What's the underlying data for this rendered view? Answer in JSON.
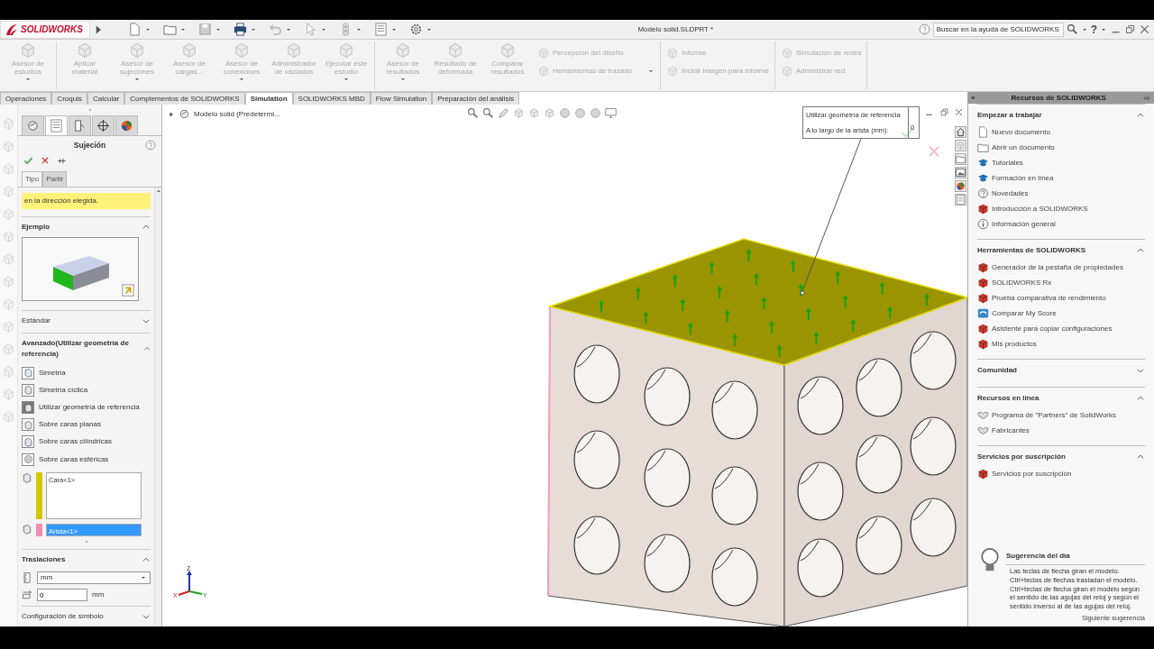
{
  "title_bar": {
    "logo": "SOLIDWORKS",
    "document_title": "Modelo solid.SLDPRT *",
    "search_placeholder": "Buscar en la ayuda de SOLIDWORKS",
    "help_label": "?"
  },
  "ribbon": {
    "groups": [
      {
        "items": [
          {
            "kind": "large",
            "label": "Asesor de estudios",
            "dropdown": true,
            "disabled": true
          }
        ]
      },
      {
        "items": [
          {
            "kind": "large",
            "label": "Aplicar material",
            "dropdown": false,
            "disabled": true
          },
          {
            "kind": "large",
            "label": "Asesor de sujeciones",
            "dropdown": true,
            "disabled": true
          },
          {
            "kind": "large",
            "label": "Asesor de cargas...",
            "dropdown": false,
            "disabled": true
          },
          {
            "kind": "large",
            "label": "Asesor de conexiones",
            "dropdown": true,
            "disabled": true
          },
          {
            "kind": "large",
            "label": "Administrador de vaciados",
            "dropdown": false,
            "disabled": true
          },
          {
            "kind": "large",
            "label": "Ejecutar este estudio",
            "dropdown": true,
            "disabled": true
          }
        ]
      },
      {
        "items": [
          {
            "kind": "large",
            "label": "Asesor de resultados",
            "dropdown": true,
            "disabled": true
          },
          {
            "kind": "large",
            "label": "Resultado de deformada",
            "dropdown": false,
            "disabled": true
          },
          {
            "kind": "large",
            "label": "Comparar resultados",
            "dropdown": false,
            "disabled": true
          },
          {
            "kind": "column",
            "items": [
              {
                "label": "Percepción del diseño",
                "dropdown": false,
                "disabled": true
              },
              {
                "label": "Herramientas de trazado",
                "dropdown": true,
                "disabled": true
              }
            ]
          }
        ]
      },
      {
        "items": [
          {
            "kind": "column",
            "items": [
              {
                "label": "Informe",
                "dropdown": false,
                "disabled": true
              },
              {
                "label": "Incluir imagen para informe",
                "dropdown": false,
                "disabled": true
              }
            ]
          }
        ]
      },
      {
        "items": [
          {
            "kind": "column",
            "items": [
              {
                "label": "Simulación de redes",
                "dropdown": false,
                "disabled": true
              },
              {
                "label": "Administrar red",
                "dropdown": false,
                "disabled": true
              }
            ]
          }
        ]
      }
    ]
  },
  "tabs": [
    {
      "label": "Operaciones",
      "selected": false
    },
    {
      "label": "Croquis",
      "selected": false
    },
    {
      "label": "Calcular",
      "selected": false
    },
    {
      "label": "Complementos de SOLIDWORKS",
      "selected": false
    },
    {
      "label": "Simulation",
      "selected": true
    },
    {
      "label": "SOLIDWORKS MBD",
      "selected": false
    },
    {
      "label": "Flow Simulation",
      "selected": false
    },
    {
      "label": "Preparación del análisis",
      "selected": false
    }
  ],
  "property_manager": {
    "tabs": [
      {
        "selected": false
      },
      {
        "selected": true
      },
      {
        "selected": false
      },
      {
        "selected": false
      },
      {
        "selected": false
      }
    ],
    "title": "Sujeción",
    "type_tabs": [
      {
        "label": "Tipo",
        "selected": true
      },
      {
        "label": "Partir",
        "selected": false
      }
    ],
    "message": "en la dirección elegida.",
    "sections": [
      {
        "kind": "example",
        "title": "Ejemplo",
        "expanded": true
      },
      {
        "kind": "header",
        "title": "Estándar",
        "expanded": false
      },
      {
        "kind": "advanced",
        "title": "Avanzado(Utilizar geometría de referencia)",
        "expanded": true,
        "options": [
          {
            "label": "Simetría",
            "selected": false
          },
          {
            "label": "Simetría cíclica",
            "selected": false
          },
          {
            "label": "Utilizar geometría de referencia",
            "selected": true
          },
          {
            "label": "Sobre caras planas",
            "selected": false
          },
          {
            "label": "Sobre caras cilíndricas",
            "selected": false
          },
          {
            "label": "Sobre caras esféricas",
            "selected": false
          }
        ],
        "selections": [
          {
            "value": "Cara<1>",
            "color": "#d4c600",
            "selected": false
          },
          {
            "value": "Arista<1>",
            "color": "#f08cb4",
            "selected": true
          }
        ]
      },
      {
        "kind": "translations",
        "title": "Traslaciones",
        "expanded": true,
        "unit": "mm",
        "value": "0",
        "value_unit": "mm"
      },
      {
        "kind": "header",
        "title": "Configuración de símbolo",
        "expanded": false
      }
    ]
  },
  "viewport": {
    "breadcrumb": "Modelo solid (Predetermi...",
    "callout": [
      {
        "label": "Utilizar geometría de referencia"
      },
      {
        "label": "A lo largo de la arista (mm):",
        "value": "0"
      }
    ],
    "triad": [
      "Z",
      "X",
      "Y"
    ]
  },
  "task_pane": {
    "collapse": "«",
    "title": "Recursos de SOLIDWORKS",
    "sections": [
      {
        "title": "Empezar a trabajar",
        "expanded": true,
        "items": [
          "Nuevo documento",
          "Abrir un documento",
          "Tutoriales",
          "Formación en línea",
          "Novedades",
          "Introducción a SOLIDWORKS",
          "Información general"
        ]
      },
      {
        "title": "Herramientas de SOLIDWORKS",
        "expanded": true,
        "items": [
          "Generador de la pestaña de propiedades",
          "SOLIDWORKS Rx",
          "Prueba comparativa de rendimiento",
          "Comparar My Score",
          "Asistente para copiar configuraciones",
          "Mis productos"
        ]
      },
      {
        "title": "Comunidad",
        "expanded": false
      },
      {
        "title": "Recursos en línea",
        "expanded": true,
        "items": [
          "Programa de \"Partners\" de SolidWorks",
          "Fabricantes"
        ]
      },
      {
        "title": "Servicios por suscripción",
        "expanded": true,
        "items": [
          "Servicios por suscripción"
        ]
      }
    ],
    "tip": {
      "title": "Sugerencia del día",
      "text": "Las teclas de flecha giran el modelo. Ctrl+teclas de flechas trasladan el modelo. Ctrl+teclas de flecha giran el modelo según el sentido de las agujas del reloj y según el sentido inverso al de las agujas del reloj.",
      "link": "Siguiente sugerencia"
    }
  }
}
